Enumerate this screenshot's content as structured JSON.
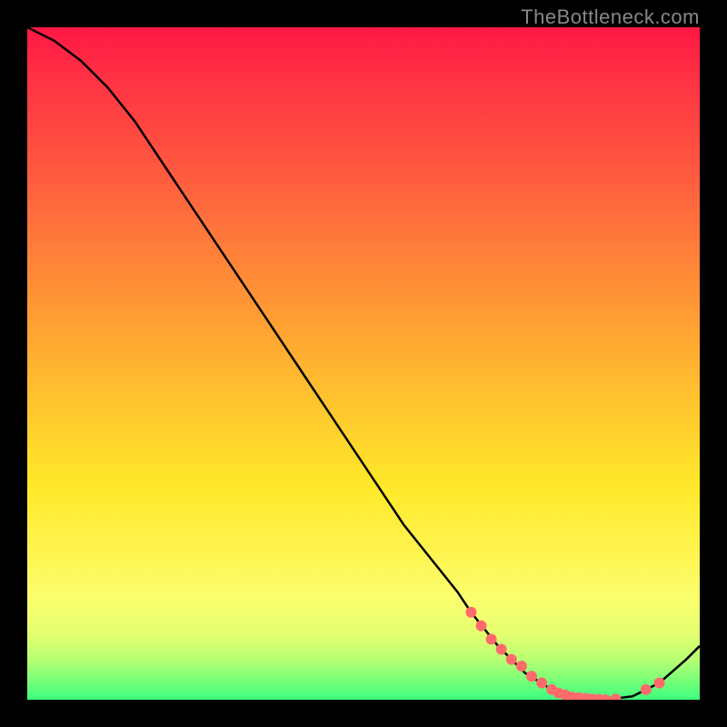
{
  "watermark": "TheBottleneck.com",
  "chart_data": {
    "type": "line",
    "title": "",
    "xlabel": "",
    "ylabel": "",
    "xlim": [
      0,
      100
    ],
    "ylim": [
      0,
      100
    ],
    "grid": false,
    "series": [
      {
        "name": "bottleneck-curve",
        "x": [
          0,
          4,
          8,
          12,
          16,
          20,
          24,
          28,
          32,
          36,
          40,
          44,
          48,
          52,
          56,
          60,
          64,
          66,
          70,
          74,
          78,
          82,
          86,
          90,
          94,
          98,
          100
        ],
        "values": [
          100,
          98,
          95,
          91,
          86,
          80,
          74,
          68,
          62,
          56,
          50,
          44,
          38,
          32,
          26,
          21,
          16,
          13,
          8,
          4,
          1.5,
          0.3,
          0,
          0.5,
          2.5,
          6,
          8
        ]
      }
    ],
    "markers": [
      {
        "x": 66,
        "y": 13
      },
      {
        "x": 67.5,
        "y": 11
      },
      {
        "x": 69,
        "y": 9
      },
      {
        "x": 70.5,
        "y": 7.5
      },
      {
        "x": 72,
        "y": 6
      },
      {
        "x": 73.5,
        "y": 5
      },
      {
        "x": 75,
        "y": 3.5
      },
      {
        "x": 76.5,
        "y": 2.5
      },
      {
        "x": 78,
        "y": 1.5
      },
      {
        "x": 79,
        "y": 1
      },
      {
        "x": 80,
        "y": 0.7
      },
      {
        "x": 81,
        "y": 0.4
      },
      {
        "x": 82,
        "y": 0.3
      },
      {
        "x": 83,
        "y": 0.2
      },
      {
        "x": 84,
        "y": 0.1
      },
      {
        "x": 85,
        "y": 0.05
      },
      {
        "x": 86,
        "y": 0
      },
      {
        "x": 87.5,
        "y": 0.1
      },
      {
        "x": 92,
        "y": 1.5
      },
      {
        "x": 94,
        "y": 2.5
      }
    ],
    "colors": {
      "curve": "#000000",
      "marker": "#ff6b6b"
    }
  }
}
